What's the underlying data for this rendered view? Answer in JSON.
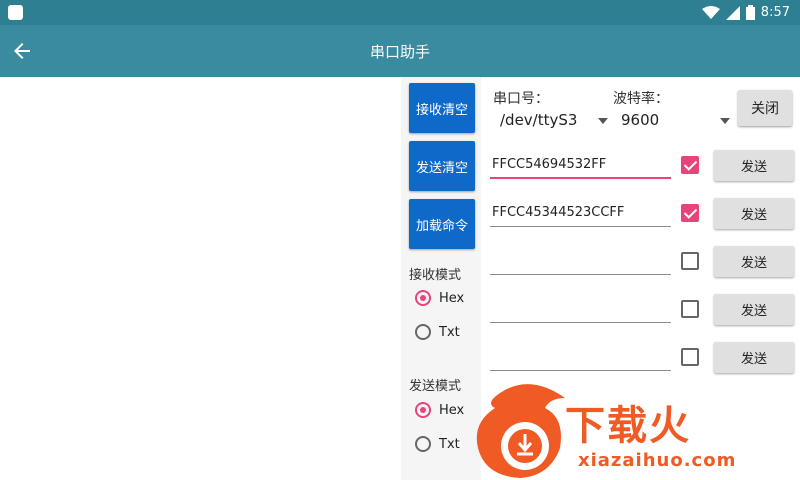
{
  "status": {
    "time": "8:57",
    "wifi_icon": "wifi-icon",
    "signal_icon": "signal-icon",
    "battery_icon": "battery-icon"
  },
  "appbar": {
    "title": "串口助手"
  },
  "buttons": {
    "clear_receive": "接收清空",
    "clear_send": "发送清空",
    "load_cmd": "加载命令",
    "close": "关闭",
    "send": "发送"
  },
  "receive_mode": {
    "title": "接收模式",
    "options": [
      "Hex",
      "Txt"
    ],
    "selected": "Hex"
  },
  "send_mode": {
    "title": "发送模式",
    "options": [
      "Hex",
      "Txt"
    ],
    "selected": "Hex"
  },
  "port": {
    "label": "串口号：",
    "value": "/dev/ttyS3"
  },
  "baud": {
    "label": "波特率：",
    "value": "9600"
  },
  "commands": [
    {
      "value": "FFCC54694532FF",
      "checked": true
    },
    {
      "value": "FFCC45344523CCFF",
      "checked": true
    },
    {
      "value": "",
      "checked": false
    },
    {
      "value": "",
      "checked": false
    },
    {
      "value": "",
      "checked": false
    }
  ],
  "watermark": {
    "brand": "下载火",
    "url": "xiazaihuo.com"
  },
  "colors": {
    "status_bar": "#2f7f93",
    "app_bar": "#3a8ba0",
    "blue_button": "#0f69c9",
    "accent": "#e8447a",
    "watermark": "#f05a24"
  }
}
